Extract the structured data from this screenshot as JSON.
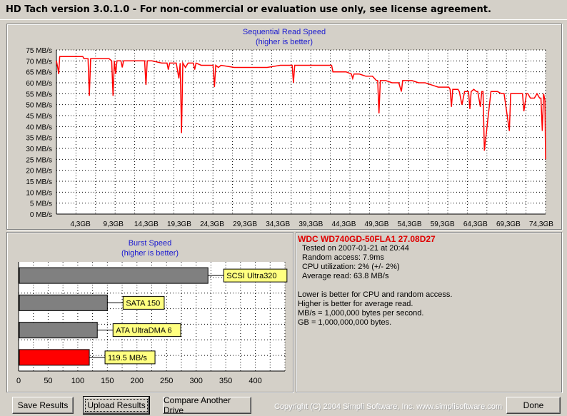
{
  "window": {
    "title": "HD Tach version 3.0.1.0  - For non-commercial or evaluation use only, see license agreement."
  },
  "seq_chart": {
    "title": "Sequential Read Speed",
    "subtitle": "(higher is better)"
  },
  "burst_chart": {
    "title": "Burst Speed",
    "subtitle": "(higher is better)"
  },
  "info": {
    "drive": "WDC WD740GD-50FLA1 27.08D27",
    "tested_on": "Tested on 2007-01-21 at 20:44",
    "random_access": "Random access: 7.9ms",
    "cpu": "CPU utilization: 2% (+/- 2%)",
    "avg_read": "Average read: 63.8 MB/s",
    "note1": "Lower is better for CPU and random access.",
    "note2": "Higher is better for average read.",
    "note3": "MB/s = 1,000,000 bytes per second.",
    "note4": "GB = 1,000,000,000 bytes."
  },
  "buttons": {
    "save": "Save Results",
    "upload": "Upload Results",
    "compare": "Compare Another Drive",
    "done": "Done"
  },
  "copyright": "Copyright (C) 2004 Simpli Software, Inc. www.simplisoftware.com",
  "colors": {
    "series": "#ff0000",
    "title_blue": "#1a1ad0",
    "drive_name": "#e00000",
    "label_yellow": "#ffff80",
    "bar_gray": "#808080"
  },
  "chart_data": [
    {
      "type": "line",
      "title": "Sequential Read Speed",
      "subtitle": "(higher is better)",
      "ylabel": "",
      "xlabel": "",
      "ylim": [
        0,
        75
      ],
      "xlim": [
        0,
        74.3
      ],
      "grid": true,
      "y_ticks": [
        "0 MB/s",
        "5 MB/s",
        "10 MB/s",
        "15 MB/s",
        "20 MB/s",
        "25 MB/s",
        "30 MB/s",
        "35 MB/s",
        "40 MB/s",
        "45 MB/s",
        "50 MB/s",
        "55 MB/s",
        "60 MB/s",
        "65 MB/s",
        "70 MB/s",
        "75 MB/s"
      ],
      "x_ticks": [
        "4,3GB",
        "9,3GB",
        "14,3GB",
        "19,3GB",
        "24,3GB",
        "29,3GB",
        "34,3GB",
        "39,3GB",
        "44,3GB",
        "49,3GB",
        "54,3GB",
        "59,3GB",
        "64,3GB",
        "69,3GB",
        "74,3GB"
      ],
      "x_tick_values": [
        4.3,
        9.3,
        14.3,
        19.3,
        24.3,
        29.3,
        34.3,
        39.3,
        44.3,
        49.3,
        54.3,
        59.3,
        64.3,
        69.3,
        74.3
      ],
      "series": [
        {
          "x": [
            0,
            0.2,
            0.35,
            0.5,
            1.0,
            2.0,
            3.0,
            4.0,
            4.2,
            4.8,
            5.0,
            5.2,
            5.4,
            5.6,
            5.8,
            6.0,
            7.0,
            8.0,
            8.4,
            8.6,
            8.8,
            9.0,
            9.2,
            9.4,
            9.8,
            10.0,
            10.2,
            10.4,
            10.6,
            11.0,
            12.0,
            13.0,
            13.4,
            13.6,
            13.8,
            14.5,
            16.0,
            16.8,
            17.0,
            17.2,
            17.6,
            17.8,
            18.2,
            18.6,
            18.8,
            19.0,
            19.2,
            19.6,
            20.0,
            20.8,
            21.0,
            21.2,
            22.0,
            23.0,
            23.8,
            24.0,
            24.2,
            24.6,
            25.0,
            27.0,
            28.8,
            29.0,
            29.2,
            30.0,
            32.0,
            34.0,
            35.8,
            36.0,
            36.2,
            38.0,
            40.0,
            41.8,
            42.0,
            42.2,
            43.0,
            44.0,
            44.8,
            45.0,
            45.2,
            46.0,
            47.0,
            48.0,
            48.6,
            48.8,
            49.0,
            49.2,
            49.6,
            50.0,
            51.0,
            52.0,
            52.4,
            52.6,
            52.8,
            53.0,
            53.2,
            54.0,
            55.0,
            56.0,
            57.0,
            58.0,
            59.0,
            59.6,
            59.8,
            60.0,
            60.2,
            60.8,
            61.0,
            61.2,
            61.6,
            62.0,
            62.6,
            62.8,
            63.0,
            63.4,
            63.8,
            64.0,
            64.4,
            64.6,
            64.8,
            65.0,
            66.0,
            67.0,
            67.6,
            67.8,
            68.0,
            68.8,
            69.0,
            69.2,
            70.0,
            70.8,
            71.0,
            71.4,
            71.6,
            72.0,
            72.6,
            73.0,
            73.4,
            73.6,
            73.8,
            74.0,
            74.2,
            74.3
          ],
          "y": [
            70,
            67,
            64,
            72,
            72,
            72,
            72,
            72,
            71,
            71,
            54,
            71,
            71,
            71,
            71,
            71,
            71,
            71,
            70,
            54,
            70,
            64,
            70,
            70,
            70,
            67,
            70,
            70,
            70,
            70,
            70,
            70,
            70,
            59,
            70,
            70,
            69,
            69,
            66,
            69,
            69,
            69,
            69,
            62,
            69,
            37,
            69,
            67,
            69,
            69,
            66,
            69,
            68,
            68,
            68,
            58,
            68,
            67,
            68,
            67,
            67,
            67,
            67,
            67,
            67,
            68,
            68,
            60,
            68,
            68,
            68,
            68,
            65,
            65,
            65,
            65,
            64,
            62,
            64,
            64,
            63,
            63,
            61,
            61,
            46,
            61,
            61,
            61,
            60,
            60,
            56,
            61,
            61,
            61,
            61,
            61,
            60,
            60,
            59,
            58,
            58,
            58,
            57,
            49,
            57,
            57,
            57,
            56,
            50,
            56,
            56,
            48,
            56,
            57,
            56,
            56,
            49,
            56,
            56,
            29,
            56,
            56,
            55,
            55,
            55,
            38,
            55,
            55,
            55,
            55,
            47,
            55,
            55,
            53,
            53,
            55,
            53,
            53,
            38,
            55,
            52,
            25
          ]
        }
      ]
    },
    {
      "type": "bar",
      "orientation": "horizontal",
      "title": "Burst Speed",
      "subtitle": "(higher is better)",
      "xlim": [
        0,
        450
      ],
      "x_ticks": [
        0,
        50,
        100,
        150,
        200,
        250,
        300,
        350,
        400
      ],
      "grid": true,
      "categories": [
        "SCSI Ultra320",
        "SATA 150",
        "ATA UltraDMA 6",
        "119.5 MB/s"
      ],
      "values": [
        320,
        150,
        133,
        119.5
      ],
      "bar_colors": [
        "#808080",
        "#808080",
        "#808080",
        "#ff0000"
      ]
    }
  ]
}
